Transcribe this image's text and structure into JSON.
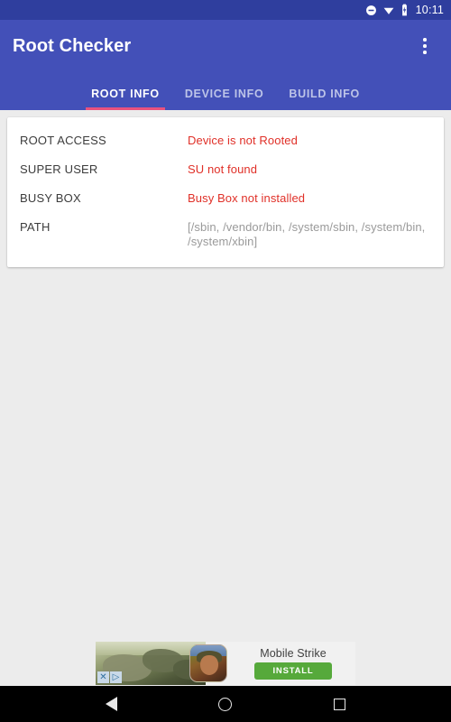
{
  "status_bar": {
    "time": "10:11",
    "icons": [
      "dnd-icon",
      "wifi-icon",
      "battery-charging-icon"
    ],
    "background": "#2F3E9E"
  },
  "app_bar": {
    "title": "Root Checker",
    "overflow_label": "More options",
    "background": "#4350B8",
    "indicator_color": "#E9527E"
  },
  "tabs": [
    {
      "label": "ROOT INFO",
      "active": true
    },
    {
      "label": "DEVICE INFO",
      "active": false
    },
    {
      "label": "BUILD INFO",
      "active": false
    }
  ],
  "root_info": {
    "rows": [
      {
        "label": "ROOT ACCESS",
        "value": "Device is not Rooted",
        "tone": "bad"
      },
      {
        "label": "SUPER USER",
        "value": "SU not found",
        "tone": "bad"
      },
      {
        "label": "BUSY BOX",
        "value": "Busy Box not installed",
        "tone": "bad"
      },
      {
        "label": "PATH",
        "value": "[/sbin, /vendor/bin, /system/sbin, /system/bin, /system/xbin]",
        "tone": "neutral"
      }
    ],
    "bad_color": "#E03028",
    "neutral_color": "#9a9a9a"
  },
  "ad": {
    "title": "Mobile Strike",
    "install_label": "INSTALL",
    "install_color": "#56A93B",
    "adchoices_x": "✕",
    "adchoices_arrow": "▷"
  },
  "nav_bar": {
    "back_label": "Back",
    "home_label": "Home",
    "recents_label": "Recent apps"
  }
}
